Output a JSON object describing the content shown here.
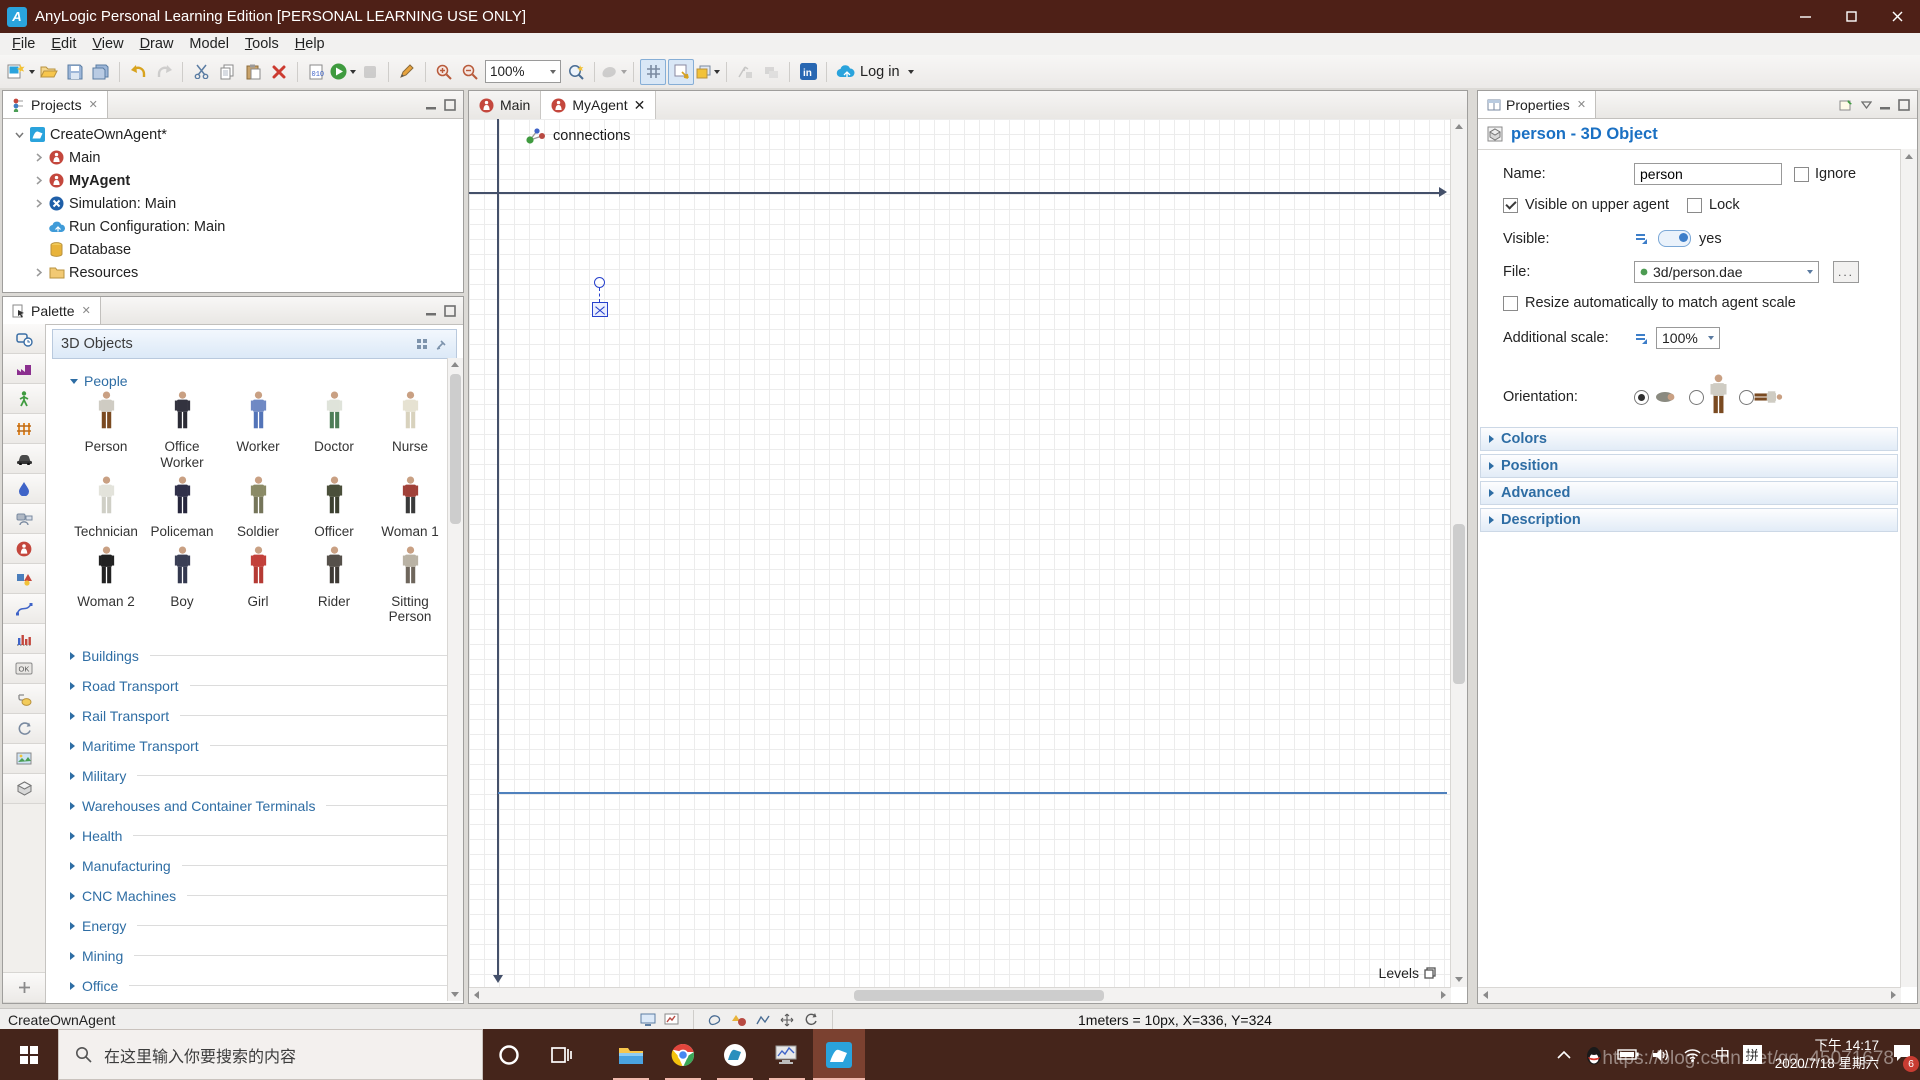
{
  "window": {
    "title": "AnyLogic Personal Learning Edition [PERSONAL LEARNING USE ONLY]"
  },
  "menu": {
    "items": [
      {
        "label": "File",
        "u": 0
      },
      {
        "label": "Edit",
        "u": 0
      },
      {
        "label": "View",
        "u": 0
      },
      {
        "label": "Draw",
        "u": 0
      },
      {
        "label": "Model",
        "u": -1
      },
      {
        "label": "Tools",
        "u": 0
      },
      {
        "label": "Help",
        "u": 0
      }
    ]
  },
  "toolbar": {
    "zoom_value": "100%",
    "login_label": "Log in"
  },
  "icons": {
    "anylogic_letter": "A",
    "linkedin_label": "in",
    "build_label": "010",
    "controls_label": "OK"
  },
  "projects": {
    "tab": "Projects",
    "tree": [
      {
        "label": "CreateOwnAgent*",
        "icon": "anylogic",
        "level": 0,
        "exp": "open",
        "bold": false
      },
      {
        "label": "Main",
        "icon": "agent",
        "level": 1,
        "exp": "closed",
        "bold": false
      },
      {
        "label": "MyAgent",
        "icon": "agent",
        "level": 1,
        "exp": "closed",
        "bold": true
      },
      {
        "label": "Simulation: Main",
        "icon": "simulation",
        "level": 1,
        "exp": "closed",
        "bold": false
      },
      {
        "label": "Run Configuration: Main",
        "icon": "runconfig",
        "level": 1,
        "exp": "none",
        "bold": false
      },
      {
        "label": "Database",
        "icon": "database",
        "level": 1,
        "exp": "none",
        "bold": false
      },
      {
        "label": "Resources",
        "icon": "folder",
        "level": 1,
        "exp": "closed",
        "bold": false
      }
    ]
  },
  "palette": {
    "tab": "Palette",
    "header": "3D Objects",
    "people_section": "People",
    "people": [
      {
        "label": "Person",
        "shirt": "#cfccc3",
        "pants": "#7a4a21"
      },
      {
        "label": "Office Worker",
        "shirt": "#33333f",
        "pants": "#2b2b35"
      },
      {
        "label": "Worker",
        "shirt": "#6f89c4",
        "pants": "#5374b8"
      },
      {
        "label": "Doctor",
        "shirt": "#dfe3da",
        "pants": "#4d7d57"
      },
      {
        "label": "Nurse",
        "shirt": "#e6e2d2",
        "pants": "#d8d2bd"
      },
      {
        "label": "Technician",
        "shirt": "#e3e3db",
        "pants": "#cfcfc6"
      },
      {
        "label": "Policeman",
        "shirt": "#30304a",
        "pants": "#26263c"
      },
      {
        "label": "Soldier",
        "shirt": "#8a8a66",
        "pants": "#75755a"
      },
      {
        "label": "Officer",
        "shirt": "#4a4f3a",
        "pants": "#3c4030"
      },
      {
        "label": "Woman 1",
        "shirt": "#a04038",
        "pants": "#3a3a3a"
      },
      {
        "label": "Woman 2",
        "shirt": "#222222",
        "pants": "#222222"
      },
      {
        "label": "Boy",
        "shirt": "#3a3f55",
        "pants": "#33384e"
      },
      {
        "label": "Girl",
        "shirt": "#c2403a",
        "pants": "#b53a34"
      },
      {
        "label": "Rider",
        "shirt": "#55504a",
        "pants": "#3e3a35"
      },
      {
        "label": "Sitting Person",
        "shirt": "#b9b2a4",
        "pants": "#6e665c"
      }
    ],
    "categories": [
      "Buildings",
      "Road Transport",
      "Rail Transport",
      "Maritime Transport",
      "Military",
      "Warehouses and Container Terminals",
      "Health",
      "Manufacturing",
      "CNC Machines",
      "Energy",
      "Mining",
      "Office"
    ]
  },
  "editor": {
    "tabs": [
      {
        "label": "Main",
        "active": false
      },
      {
        "label": "MyAgent",
        "active": true
      }
    ],
    "connections_label": "connections",
    "levels_label": "Levels"
  },
  "properties": {
    "tab": "Properties",
    "title": "person - 3D Object",
    "name_label": "Name:",
    "name_value": "person",
    "ignore_label": "Ignore",
    "visible_upper_label": "Visible on upper agent",
    "lock_label": "Lock",
    "visible_label": "Visible:",
    "visible_value": "yes",
    "file_label": "File:",
    "file_value": "3d/person.dae",
    "file_button": "...",
    "resize_label": "Resize automatically to match agent scale",
    "scale_label": "Additional scale:",
    "scale_value": "100%",
    "orientation_label": "Orientation:",
    "sections": [
      "Colors",
      "Position",
      "Advanced",
      "Description"
    ]
  },
  "statusbar": {
    "project": "CreateOwnAgent",
    "scale_info": "1meters = 10px, X=336, Y=324"
  },
  "taskbar": {
    "search_placeholder": "在这里输入你要搜索的内容",
    "ime_primary": "中",
    "ime_secondary": "拼",
    "time": "下午 14:17",
    "date": "2020/7/18 星期六",
    "notification_count": "6"
  },
  "watermark": "https://blog.csdn.net/qq_45071678",
  "colors": {
    "titlebar": "#4e2017",
    "taskbar": "#45251b",
    "accent_blue": "#1a70c3",
    "section_blue": "#2e6da4"
  }
}
